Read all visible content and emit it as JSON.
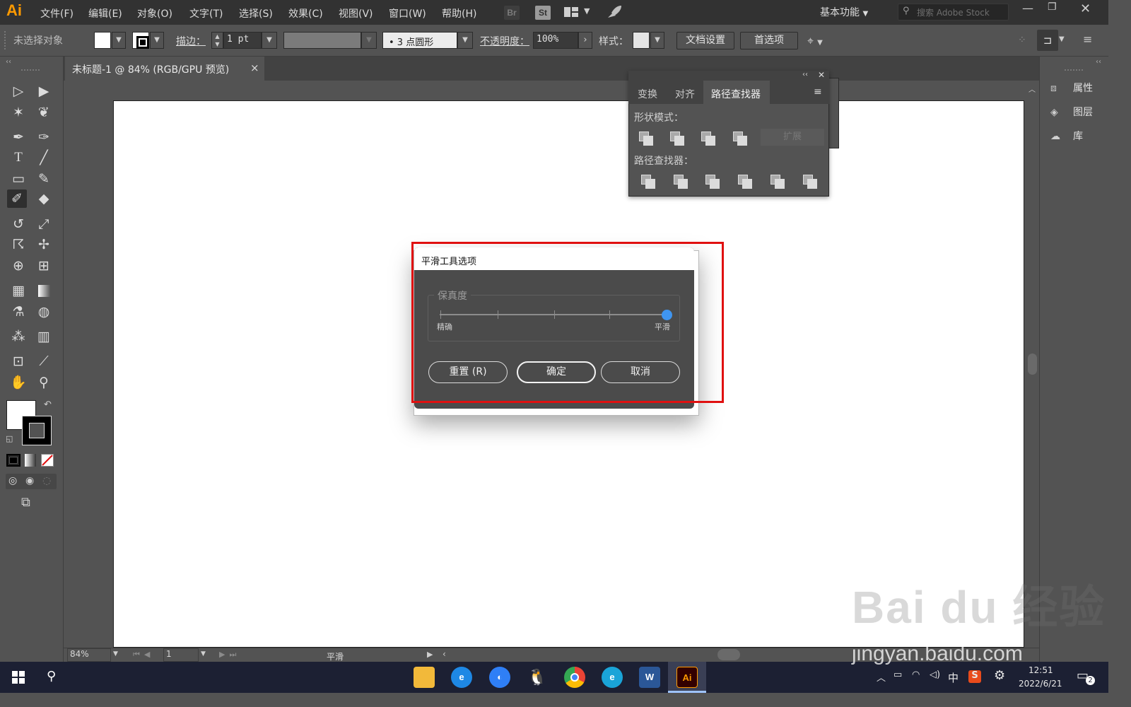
{
  "app": {
    "logo": "Ai",
    "workspace": "基本功能",
    "search_placeholder": "搜索 Adobe Stock",
    "bridge": "Br",
    "stock": "St"
  },
  "menu": [
    "文件(F)",
    "编辑(E)",
    "对象(O)",
    "文字(T)",
    "选择(S)",
    "效果(C)",
    "视图(V)",
    "窗口(W)",
    "帮助(H)"
  ],
  "controlbar": {
    "selection": "未选择对象",
    "stroke_label": "描边：",
    "stroke_value": "1 pt",
    "brush": "•  3 点圆形",
    "opacity_label": "不透明度：",
    "opacity_value": "100%",
    "style_label": "样式：",
    "doc_setup": "文档设置",
    "prefs": "首选项"
  },
  "document_tab": {
    "title": "未标题-1 @ 84% (RGB/GPU 预览)",
    "close": "×"
  },
  "pathfinder": {
    "tabs": [
      "变换",
      "对齐",
      "路径查找器"
    ],
    "shape_modes_label": "形状模式：",
    "pathfinders_label": "路径查找器：",
    "expand": "扩展"
  },
  "right_panel": {
    "items": [
      "属性",
      "图层",
      "库"
    ]
  },
  "dialog": {
    "title": "平滑工具选项",
    "group_label": "保真度",
    "slider_left": "精确",
    "slider_right": "平滑",
    "slider_value": 1.0,
    "reset": "重置 (R)",
    "ok": "确定",
    "cancel": "取消"
  },
  "statusbar": {
    "zoom": "84%",
    "page": "1",
    "tool": "平滑"
  },
  "taskbar": {
    "ime": "中",
    "time": "12:51",
    "date": "2022/6/21",
    "notifications": "2",
    "active_app": "Ai"
  },
  "watermark": {
    "brand": "Bai du 经验",
    "url": "jingyan.baidu.com"
  },
  "colors": {
    "accent": "#3f95f0",
    "highlight_box": "#e01010",
    "logo": "#ff9a00"
  }
}
